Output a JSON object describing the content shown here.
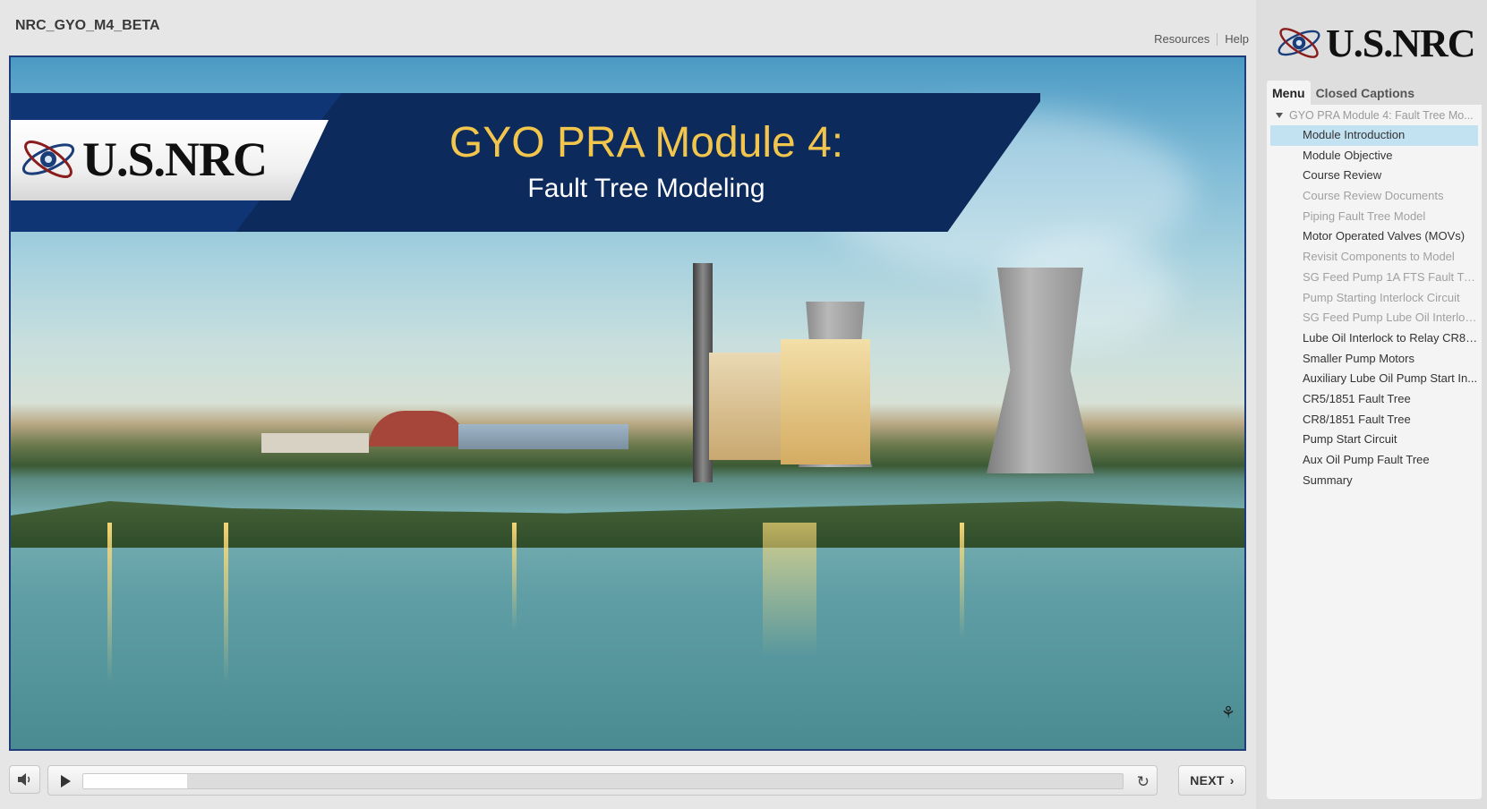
{
  "window": {
    "course_title": "NRC_GYO_M4_BETA"
  },
  "toplinks": {
    "resources": "Resources",
    "help": "Help"
  },
  "slide": {
    "logo_text": "U.S.NRC",
    "title": "GYO PRA Module 4:",
    "subtitle": "Fault Tree Modeling"
  },
  "controls": {
    "next_label": "NEXT",
    "progress": 0.1,
    "icons": {
      "volume": "speaker-icon",
      "play": "play-icon",
      "replay": "replay-icon",
      "next": "chevron-right-icon"
    }
  },
  "sidebar": {
    "logo_text": "U.S.NRC",
    "tabs": [
      {
        "label": "Menu",
        "active": true
      },
      {
        "label": "Closed Captions",
        "active": false
      }
    ],
    "menu_root": "GYO PRA Module 4:  Fault Tree Mo...",
    "items": [
      {
        "label": "Module Introduction",
        "state": "selected"
      },
      {
        "label": "Module Objective",
        "state": "normal"
      },
      {
        "label": "Course Review",
        "state": "normal"
      },
      {
        "label": "Course Review Documents",
        "state": "dim"
      },
      {
        "label": "Piping Fault Tree Model",
        "state": "dim"
      },
      {
        "label": "Motor Operated Valves (MOVs)",
        "state": "normal"
      },
      {
        "label": "Revisit Components to Model",
        "state": "dim"
      },
      {
        "label": "SG Feed Pump 1A FTS Fault Tre...",
        "state": "dim"
      },
      {
        "label": "Pump Starting Interlock Circuit",
        "state": "dim"
      },
      {
        "label": "SG Feed Pump Lube Oil Interloc...",
        "state": "dim"
      },
      {
        "label": "Lube Oil Interlock to Relay CR8/...",
        "state": "normal"
      },
      {
        "label": "Smaller Pump Motors",
        "state": "normal"
      },
      {
        "label": "Auxiliary Lube Oil Pump Start In...",
        "state": "normal"
      },
      {
        "label": "CR5/1851 Fault Tree",
        "state": "normal"
      },
      {
        "label": "CR8/1851 Fault Tree",
        "state": "normal"
      },
      {
        "label": "Pump Start Circuit",
        "state": "normal"
      },
      {
        "label": "Aux Oil Pump Fault Tree",
        "state": "normal"
      },
      {
        "label": "Summary",
        "state": "normal"
      }
    ]
  },
  "colors": {
    "banner_navy": "#0c2a5c",
    "title_gold": "#f2c64d",
    "menu_selected": "#c2e1f1",
    "slide_border": "#1f3d7a"
  }
}
